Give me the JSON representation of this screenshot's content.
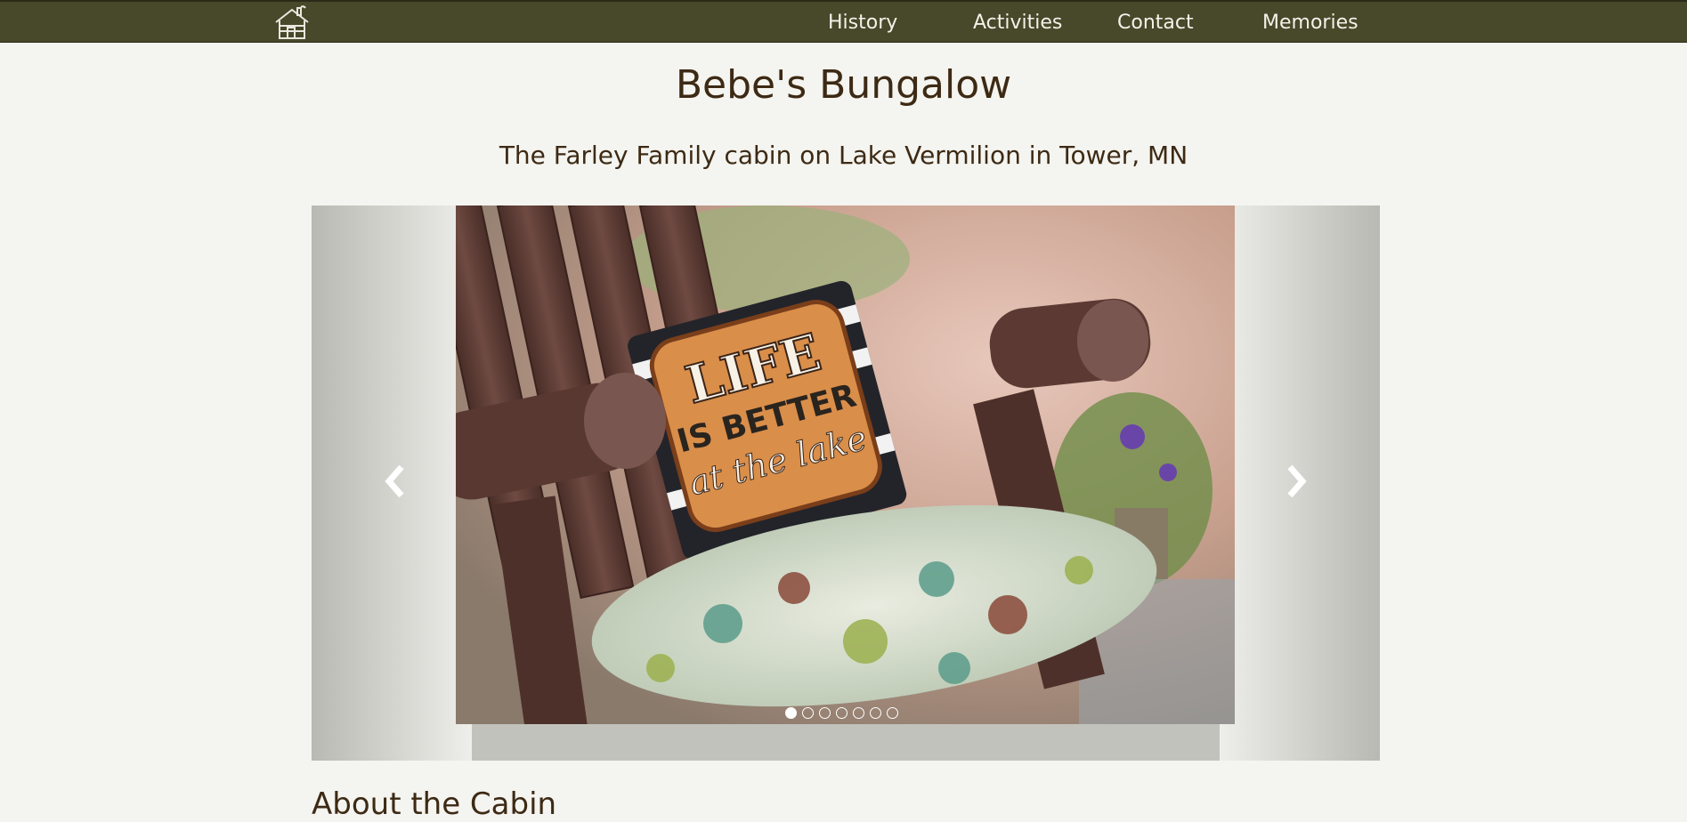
{
  "nav": {
    "logo_icon": "cabin-icon",
    "links": [
      {
        "label": "History"
      },
      {
        "label": "Activities"
      },
      {
        "label": "Contact"
      },
      {
        "label": "Memories"
      }
    ]
  },
  "header": {
    "title": "Bebe's Bungalow",
    "tagline": "The Farley Family cabin on Lake Vermilion in Tower, MN"
  },
  "carousel": {
    "slide_image": "porch-rocking-chair-pillow",
    "pillow_text": [
      "LIFE",
      "IS BETTER",
      "at the lake"
    ],
    "prev_icon": "chevron-left-icon",
    "next_icon": "chevron-right-icon",
    "slide_count": 7,
    "active_slide": 1
  },
  "section": {
    "heading": "About the Cabin"
  },
  "colors": {
    "navbar": "#48482a",
    "page_background": "#f4f4f0",
    "text": "#3d2a14"
  }
}
